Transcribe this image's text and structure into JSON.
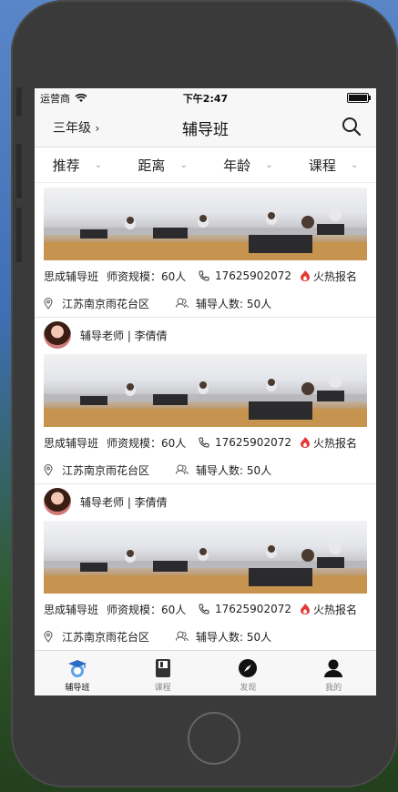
{
  "status": {
    "carrier": "运营商",
    "time": "下午2:47"
  },
  "navbar": {
    "grade": "三年级",
    "grade_arrow": "›",
    "title": "辅导班"
  },
  "filters": [
    {
      "label": "推荐",
      "chev": "⌄"
    },
    {
      "label": "距离",
      "chev": "⌄"
    },
    {
      "label": "年龄",
      "chev": "⌄"
    },
    {
      "label": "课程",
      "chev": "⌄"
    }
  ],
  "cards": [
    {
      "name": "思成辅导班",
      "scale": "师资规模：60人",
      "phone": "17625902072",
      "hot": "火热报名",
      "address": "江苏南京雨花台区",
      "count": "辅导人数: 50人",
      "teacher": ""
    },
    {
      "name": "思成辅导班",
      "scale": "师资规模：60人",
      "phone": "17625902072",
      "hot": "火热报名",
      "address": "江苏南京雨花台区",
      "count": "辅导人数: 50人",
      "teacher": "辅导老师 | 李倩倩"
    },
    {
      "name": "思成辅导班",
      "scale": "师资规模：60人",
      "phone": "17625902072",
      "hot": "火热报名",
      "address": "江苏南京雨花台区",
      "count": "辅导人数: 50人",
      "teacher": "辅导老师 | 李倩倩"
    }
  ],
  "tabbar": [
    {
      "label": "辅导班",
      "icon": "graduation-cap-icon",
      "active": true
    },
    {
      "label": "课程",
      "icon": "book-icon",
      "active": false
    },
    {
      "label": "发现",
      "icon": "compass-icon",
      "active": false
    },
    {
      "label": "我的",
      "icon": "person-icon",
      "active": false
    }
  ],
  "colors": {
    "accent_blue": "#3b7dd8",
    "hot_red": "#e53935"
  }
}
